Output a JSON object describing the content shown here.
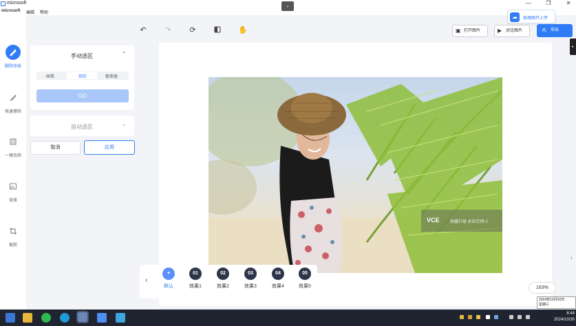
{
  "window": {
    "title": "microsoft",
    "minimize": "—",
    "restore": "❐",
    "close": "✕"
  },
  "menu": {
    "items": [
      "microsoft",
      "编辑",
      "帮助"
    ]
  },
  "collapse_icon": "chevron-down-icon",
  "upload_badge": {
    "label": "拖拽图开上传"
  },
  "sidebar": {
    "items": [
      {
        "label": "删除涂抹",
        "icon": "eraser-icon",
        "active": true
      },
      {
        "label": "快速擦除",
        "icon": "pen-icon",
        "active": false
      },
      {
        "label": "一键去除",
        "icon": "select-frame-icon",
        "active": false
      },
      {
        "label": "背景",
        "icon": "image-icon",
        "active": false
      },
      {
        "label": "裁剪",
        "icon": "crop-icon",
        "active": false
      }
    ]
  },
  "panel": {
    "manual_title": "手动选区",
    "tools": [
      "画笔",
      "矩形",
      "套索器"
    ],
    "go_label": "GO",
    "auto_title": "自动选区",
    "cancel_label": "取消",
    "apply_label": "应用"
  },
  "toolbar": {
    "open_label": "打开图片",
    "compare_label": "对比图片",
    "export_label": "导出"
  },
  "watermark": {
    "logo": "VCE",
    "text": "收藏升级 水印示例-2"
  },
  "effects": {
    "items": [
      {
        "badge": "✦",
        "label": "默认",
        "active": true
      },
      {
        "badge": "01",
        "label": "效果1",
        "active": false
      },
      {
        "badge": "02",
        "label": "效果2",
        "active": false
      },
      {
        "badge": "03",
        "label": "效果3",
        "active": false
      },
      {
        "badge": "04",
        "label": "效果4",
        "active": false
      },
      {
        "badge": "05",
        "label": "效果5",
        "active": false
      }
    ]
  },
  "zoom": {
    "level": "163%"
  },
  "right_panel_tab": "▸",
  "date_tooltip": {
    "line1": "2024年10月30日",
    "line2": "星期三"
  },
  "clock": {
    "time": "8:44",
    "date": "2024/10/30"
  },
  "colors": {
    "accent": "#2f7cf6",
    "taskbar": "#1f2430"
  }
}
